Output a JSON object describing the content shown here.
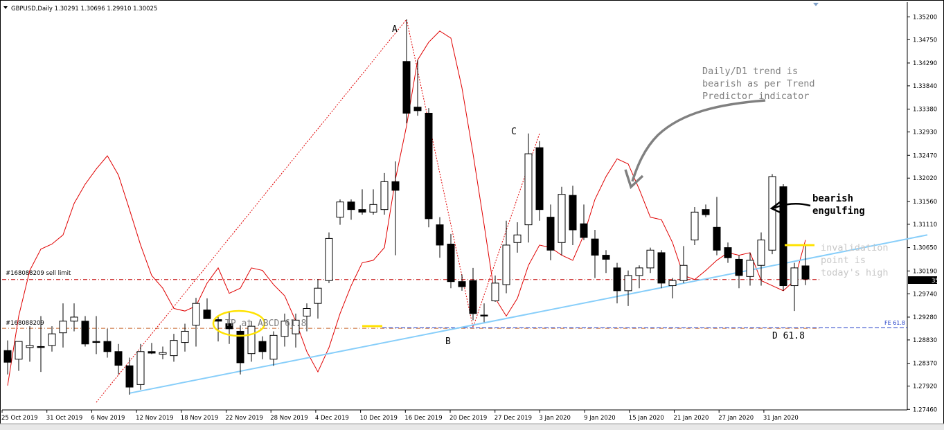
{
  "window": {
    "header": "GBPUSD,Daily  1.30291 1.30696 1.29910 1.30025",
    "menu_icon": "triangle-down-icon",
    "tab_strip_icon": "triangle-down-icon"
  },
  "chart_data": {
    "type": "candlestick",
    "symbol": "GBPUSD",
    "timeframe": "Daily",
    "ohlc_header": [
      "1.30291",
      "1.30696",
      "1.29910",
      "1.30025"
    ],
    "ylim": [
      1.2745,
      1.3545
    ],
    "y_ticks": [
      "1.35200",
      "1.34750",
      "1.34290",
      "1.33840",
      "1.33380",
      "1.32930",
      "1.32470",
      "1.32020",
      "1.31560",
      "1.31110",
      "1.30650",
      "1.30190",
      "1.29740",
      "1.29280",
      "1.28830",
      "1.28370",
      "1.27920",
      "1.27460"
    ],
    "x_tick_labels": [
      "25 Oct 2019",
      "31 Oct 2019",
      "6 Nov 2019",
      "12 Nov 2019",
      "18 Nov 2019",
      "22 Nov 2019",
      "28 Nov 2019",
      "4 Dec 2019",
      "10 Dec 2019",
      "16 Dec 2019",
      "20 Dec 2019",
      "27 Dec 2019",
      "3 Jan 2020",
      "9 Jan 2020",
      "15 Jan 2020",
      "21 Jan 2020",
      "27 Jan 2020",
      "31 Jan 2020"
    ],
    "current_price_label": "35",
    "candles": [
      {
        "o": 1.2862,
        "h": 1.2882,
        "l": 1.2815,
        "c": 1.2839
      },
      {
        "o": 1.2845,
        "h": 1.288,
        "l": 1.2822,
        "c": 1.288
      },
      {
        "o": 1.2868,
        "h": 1.291,
        "l": 1.284,
        "c": 1.2872
      },
      {
        "o": 1.287,
        "h": 1.293,
        "l": 1.282,
        "c": 1.2868
      },
      {
        "o": 1.2872,
        "h": 1.291,
        "l": 1.286,
        "c": 1.2895
      },
      {
        "o": 1.2897,
        "h": 1.2955,
        "l": 1.2868,
        "c": 1.292
      },
      {
        "o": 1.292,
        "h": 1.2955,
        "l": 1.29,
        "c": 1.2928
      },
      {
        "o": 1.292,
        "h": 1.293,
        "l": 1.287,
        "c": 1.2875
      },
      {
        "o": 1.288,
        "h": 1.293,
        "l": 1.2855,
        "c": 1.2878
      },
      {
        "o": 1.288,
        "h": 1.2905,
        "l": 1.2848,
        "c": 1.286
      },
      {
        "o": 1.286,
        "h": 1.2875,
        "l": 1.2815,
        "c": 1.2833
      },
      {
        "o": 1.2832,
        "h": 1.2848,
        "l": 1.2775,
        "c": 1.279
      },
      {
        "o": 1.2795,
        "h": 1.2875,
        "l": 1.2785,
        "c": 1.286
      },
      {
        "o": 1.286,
        "h": 1.2877,
        "l": 1.2855,
        "c": 1.2857
      },
      {
        "o": 1.2855,
        "h": 1.287,
        "l": 1.2845,
        "c": 1.2858
      },
      {
        "o": 1.2852,
        "h": 1.2895,
        "l": 1.284,
        "c": 1.2882
      },
      {
        "o": 1.2878,
        "h": 1.2915,
        "l": 1.286,
        "c": 1.29
      },
      {
        "o": 1.2912,
        "h": 1.2966,
        "l": 1.287,
        "c": 1.2955
      },
      {
        "o": 1.2942,
        "h": 1.2965,
        "l": 1.2925,
        "c": 1.2925
      },
      {
        "o": 1.2923,
        "h": 1.2932,
        "l": 1.288,
        "c": 1.292
      },
      {
        "o": 1.2915,
        "h": 1.294,
        "l": 1.2875,
        "c": 1.2905
      },
      {
        "o": 1.29,
        "h": 1.2912,
        "l": 1.2815,
        "c": 1.2838
      },
      {
        "o": 1.2856,
        "h": 1.292,
        "l": 1.284,
        "c": 1.291
      },
      {
        "o": 1.288,
        "h": 1.289,
        "l": 1.2845,
        "c": 1.286
      },
      {
        "o": 1.2845,
        "h": 1.29,
        "l": 1.2832,
        "c": 1.2892
      },
      {
        "o": 1.289,
        "h": 1.2935,
        "l": 1.287,
        "c": 1.292
      },
      {
        "o": 1.2895,
        "h": 1.2935,
        "l": 1.2868,
        "c": 1.2922
      },
      {
        "o": 1.293,
        "h": 1.2955,
        "l": 1.29,
        "c": 1.2945
      },
      {
        "o": 1.2955,
        "h": 1.3003,
        "l": 1.2925,
        "c": 1.2985
      },
      {
        "o": 1.3,
        "h": 1.3095,
        "l": 1.2995,
        "c": 1.3083
      },
      {
        "o": 1.3125,
        "h": 1.316,
        "l": 1.311,
        "c": 1.3155
      },
      {
        "o": 1.3155,
        "h": 1.316,
        "l": 1.312,
        "c": 1.314
      },
      {
        "o": 1.314,
        "h": 1.318,
        "l": 1.313,
        "c": 1.3135
      },
      {
        "o": 1.3135,
        "h": 1.318,
        "l": 1.313,
        "c": 1.315
      },
      {
        "o": 1.314,
        "h": 1.3212,
        "l": 1.313,
        "c": 1.3195
      },
      {
        "o": 1.3195,
        "h": 1.3235,
        "l": 1.305,
        "c": 1.3178
      },
      {
        "o": 1.3432,
        "h": 1.3515,
        "l": 1.331,
        "c": 1.333
      },
      {
        "o": 1.3342,
        "h": 1.3435,
        "l": 1.3325,
        "c": 1.3335
      },
      {
        "o": 1.333,
        "h": 1.334,
        "l": 1.3105,
        "c": 1.3122
      },
      {
        "o": 1.311,
        "h": 1.3125,
        "l": 1.3045,
        "c": 1.307
      },
      {
        "o": 1.3072,
        "h": 1.3092,
        "l": 1.2985,
        "c": 1.2998
      },
      {
        "o": 1.2998,
        "h": 1.3012,
        "l": 1.298,
        "c": 1.2988
      },
      {
        "o": 1.3,
        "h": 1.3025,
        "l": 1.2922,
        "c": 1.2935
      },
      {
        "o": 1.2932,
        "h": 1.2955,
        "l": 1.2918,
        "c": 1.293
      },
      {
        "o": 1.296,
        "h": 1.301,
        "l": 1.2958,
        "c": 1.2995
      },
      {
        "o": 1.2992,
        "h": 1.3118,
        "l": 1.2975,
        "c": 1.307
      },
      {
        "o": 1.3075,
        "h": 1.3115,
        "l": 1.3055,
        "c": 1.309
      },
      {
        "o": 1.311,
        "h": 1.329,
        "l": 1.3075,
        "c": 1.325
      },
      {
        "o": 1.3262,
        "h": 1.3275,
        "l": 1.3118,
        "c": 1.314
      },
      {
        "o": 1.3125,
        "h": 1.315,
        "l": 1.304,
        "c": 1.306
      },
      {
        "o": 1.3075,
        "h": 1.3185,
        "l": 1.305,
        "c": 1.317
      },
      {
        "o": 1.3168,
        "h": 1.3187,
        "l": 1.307,
        "c": 1.31
      },
      {
        "o": 1.3112,
        "h": 1.315,
        "l": 1.308,
        "c": 1.3085
      },
      {
        "o": 1.3082,
        "h": 1.31,
        "l": 1.3005,
        "c": 1.305
      },
      {
        "o": 1.305,
        "h": 1.306,
        "l": 1.3015,
        "c": 1.3042
      },
      {
        "o": 1.3025,
        "h": 1.3035,
        "l": 1.2955,
        "c": 1.298
      },
      {
        "o": 1.298,
        "h": 1.302,
        "l": 1.295,
        "c": 1.301
      },
      {
        "o": 1.301,
        "h": 1.303,
        "l": 1.2985,
        "c": 1.3025
      },
      {
        "o": 1.3025,
        "h": 1.3065,
        "l": 1.3015,
        "c": 1.306
      },
      {
        "o": 1.3055,
        "h": 1.306,
        "l": 1.2985,
        "c": 1.2995
      },
      {
        "o": 1.299,
        "h": 1.3005,
        "l": 1.2965,
        "c": 1.3
      },
      {
        "o": 1.3,
        "h": 1.3068,
        "l": 1.2995,
        "c": 1.303
      },
      {
        "o": 1.308,
        "h": 1.3145,
        "l": 1.307,
        "c": 1.3135
      },
      {
        "o": 1.314,
        "h": 1.315,
        "l": 1.3125,
        "c": 1.313
      },
      {
        "o": 1.3105,
        "h": 1.3165,
        "l": 1.305,
        "c": 1.306
      },
      {
        "o": 1.3065,
        "h": 1.3075,
        "l": 1.3035,
        "c": 1.3045
      },
      {
        "o": 1.3042,
        "h": 1.305,
        "l": 1.2985,
        "c": 1.301
      },
      {
        "o": 1.3008,
        "h": 1.3055,
        "l": 1.299,
        "c": 1.304
      },
      {
        "o": 1.303,
        "h": 1.3095,
        "l": 1.299,
        "c": 1.308
      },
      {
        "o": 1.306,
        "h": 1.321,
        "l": 1.3052,
        "c": 1.3205
      },
      {
        "o": 1.3185,
        "h": 1.319,
        "l": 1.298,
        "c": 1.299
      },
      {
        "o": 1.299,
        "h": 1.3035,
        "l": 1.294,
        "c": 1.3025
      },
      {
        "o": 1.3029,
        "h": 1.307,
        "l": 1.2991,
        "c": 1.3003
      }
    ],
    "indicator_line": [
      1.2793,
      1.293,
      1.302,
      1.3062,
      1.3072,
      1.309,
      1.3152,
      1.319,
      1.322,
      1.3246,
      1.3208,
      1.314,
      1.307,
      1.301,
      1.2985,
      1.2945,
      1.294,
      1.295,
      1.2995,
      1.3025,
      1.2975,
      1.2985,
      1.3025,
      1.302,
      1.2992,
      1.297,
      1.292,
      1.286,
      1.282,
      1.2868,
      1.2935,
      1.299,
      1.3035,
      1.304,
      1.3065,
      1.32,
      1.3305,
      1.3435,
      1.347,
      1.3492,
      1.3478,
      1.338,
      1.325,
      1.311,
      1.2965,
      1.293,
      1.2965,
      1.303,
      1.307,
      1.3065,
      1.305,
      1.304,
      1.309,
      1.316,
      1.3205,
      1.324,
      1.323,
      1.318,
      1.3125,
      1.312,
      1.3075,
      1.301,
      1.3002,
      1.302,
      1.304,
      1.3055,
      1.305,
      1.3055,
      1.3,
      1.299,
      1.298,
      1.3,
      1.308
    ],
    "sell_limit_price": 1.3002,
    "pending_order_price": 1.2906,
    "fe_level_price": 1.2907,
    "trendline": {
      "from": [
        11,
        1.2778
      ],
      "to": [
        83,
        1.309
      ]
    },
    "abcd": {
      "A": [
        36,
        1.3515
      ],
      "B": [
        42,
        1.2908
      ],
      "C": [
        48,
        1.329
      ],
      "start": [
        8,
        1.276
      ]
    },
    "labels": {
      "sell_limit": "#168088209 sell limit",
      "pending": "#168088209",
      "fe": "FE 61.8",
      "A": "A",
      "B": "B",
      "C": "C",
      "D": "D 61.8",
      "tp": "TP at ABCD 61.8",
      "trend_line1": "Daily/D1 trend is",
      "trend_line2": "bearish as per Trend",
      "trend_line3": "Predictor indicator",
      "engulf_line1": "bearish",
      "engulf_line2": "engulfing",
      "inval_line1": "invalidation",
      "inval_line2": "point is",
      "inval_line3": "today's high"
    },
    "colors": {
      "indicator": "#e00000",
      "trendline": "#87cefa",
      "highlight": "#ffe200",
      "sell_limit": "#c00000",
      "fe": "#1e3cc8",
      "annotation_gray": "#808080"
    }
  }
}
